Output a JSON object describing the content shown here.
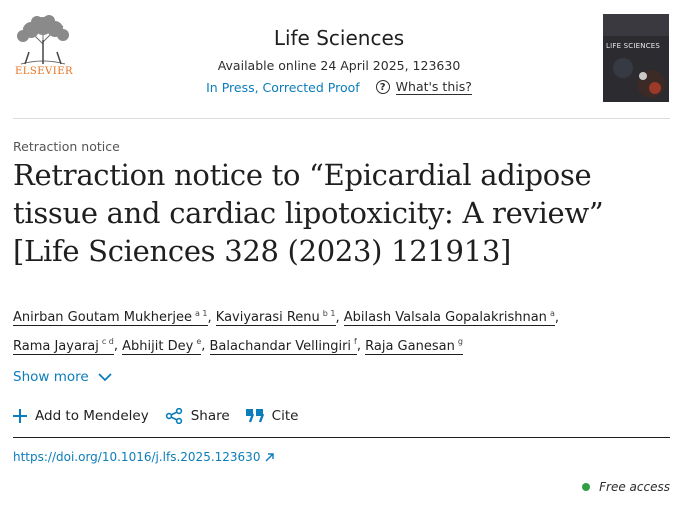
{
  "header": {
    "publisher": "ELSEVIER",
    "journal_title": "Life Sciences",
    "availability": "Available online 24 April 2025, 123630",
    "status_link": "In Press, Corrected Proof",
    "whats_this": "What's this?",
    "cover_text": "LIFE SCIENCES"
  },
  "article": {
    "type": "Retraction notice",
    "title": "Retraction notice to “Epicardial adipose tissue and cardiac lipotoxicity: A review” [Life Sciences 328 (2023) 121913]",
    "authors": [
      {
        "name": "Anirban Goutam Mukherjee",
        "sup": "a 1"
      },
      {
        "name": "Kaviyarasi Renu",
        "sup": "b 1"
      },
      {
        "name": "Abilash Valsala Gopalakrishnan",
        "sup": "a"
      },
      {
        "name": "Rama Jayaraj",
        "sup": "c d"
      },
      {
        "name": "Abhijit Dey",
        "sup": "e"
      },
      {
        "name": "Balachandar Vellingiri",
        "sup": "f"
      },
      {
        "name": "Raja Ganesan",
        "sup": "g"
      }
    ],
    "show_more": "Show more"
  },
  "actions": {
    "mendeley": "Add to Mendeley",
    "share": "Share",
    "cite": "Cite"
  },
  "doi": "https://doi.org/10.1016/j.lfs.2025.123630",
  "access": "Free access",
  "colors": {
    "link": "#0c7dbb",
    "brand": "#e9711c",
    "access_dot": "#2f9e44"
  }
}
